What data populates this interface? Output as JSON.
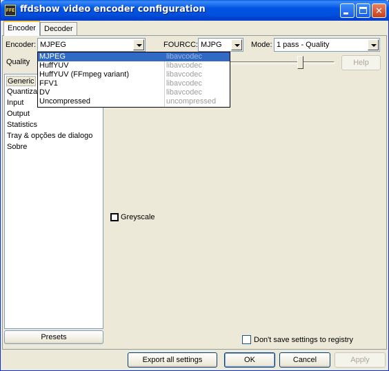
{
  "window": {
    "title": "ffdshow video encoder configuration",
    "icon_text": "FFE"
  },
  "tabs": [
    {
      "label": "Encoder",
      "active": true
    },
    {
      "label": "Decoder",
      "active": false
    }
  ],
  "encoder_row": {
    "encoder_label": "Encoder:",
    "encoder_value": "MJPEG",
    "fourcc_label": "FOURCC:",
    "fourcc_value": "MJPG",
    "mode_label": "Mode:",
    "mode_value": "1 pass - Quality"
  },
  "quality_row": {
    "label": "Quality",
    "help_label": "Help"
  },
  "tree": {
    "items": [
      "Generic",
      "Quantization",
      "Input",
      "Output",
      "Statistics",
      "Tray & opções de dialogo",
      "Sobre"
    ],
    "selected": "Generic"
  },
  "encoder_dropdown": {
    "items": [
      {
        "name": "MJPEG",
        "lib": "libavcodec",
        "selected": true
      },
      {
        "name": "HuffYUV",
        "lib": "libavcodec",
        "selected": false
      },
      {
        "name": "HuffYUV (FFmpeg variant)",
        "lib": "libavcodec",
        "selected": false
      },
      {
        "name": "FFV1",
        "lib": "libavcodec",
        "selected": false
      },
      {
        "name": "DV",
        "lib": "libavcodec",
        "selected": false
      },
      {
        "name": "Uncompressed",
        "lib": "uncompressed",
        "selected": false
      }
    ]
  },
  "page": {
    "greyscale_label": "Greyscale",
    "greyscale_checked": false
  },
  "bottom": {
    "presets_label": "Presets",
    "dont_save_label": "Don't save settings to registry",
    "dont_save_checked": false,
    "export_label": "Export all settings",
    "ok_label": "OK",
    "cancel_label": "Cancel",
    "apply_label": "Apply"
  },
  "colors": {
    "titlebar": "#0054e3",
    "selection": "#316ac5",
    "face": "#ece9d8"
  }
}
